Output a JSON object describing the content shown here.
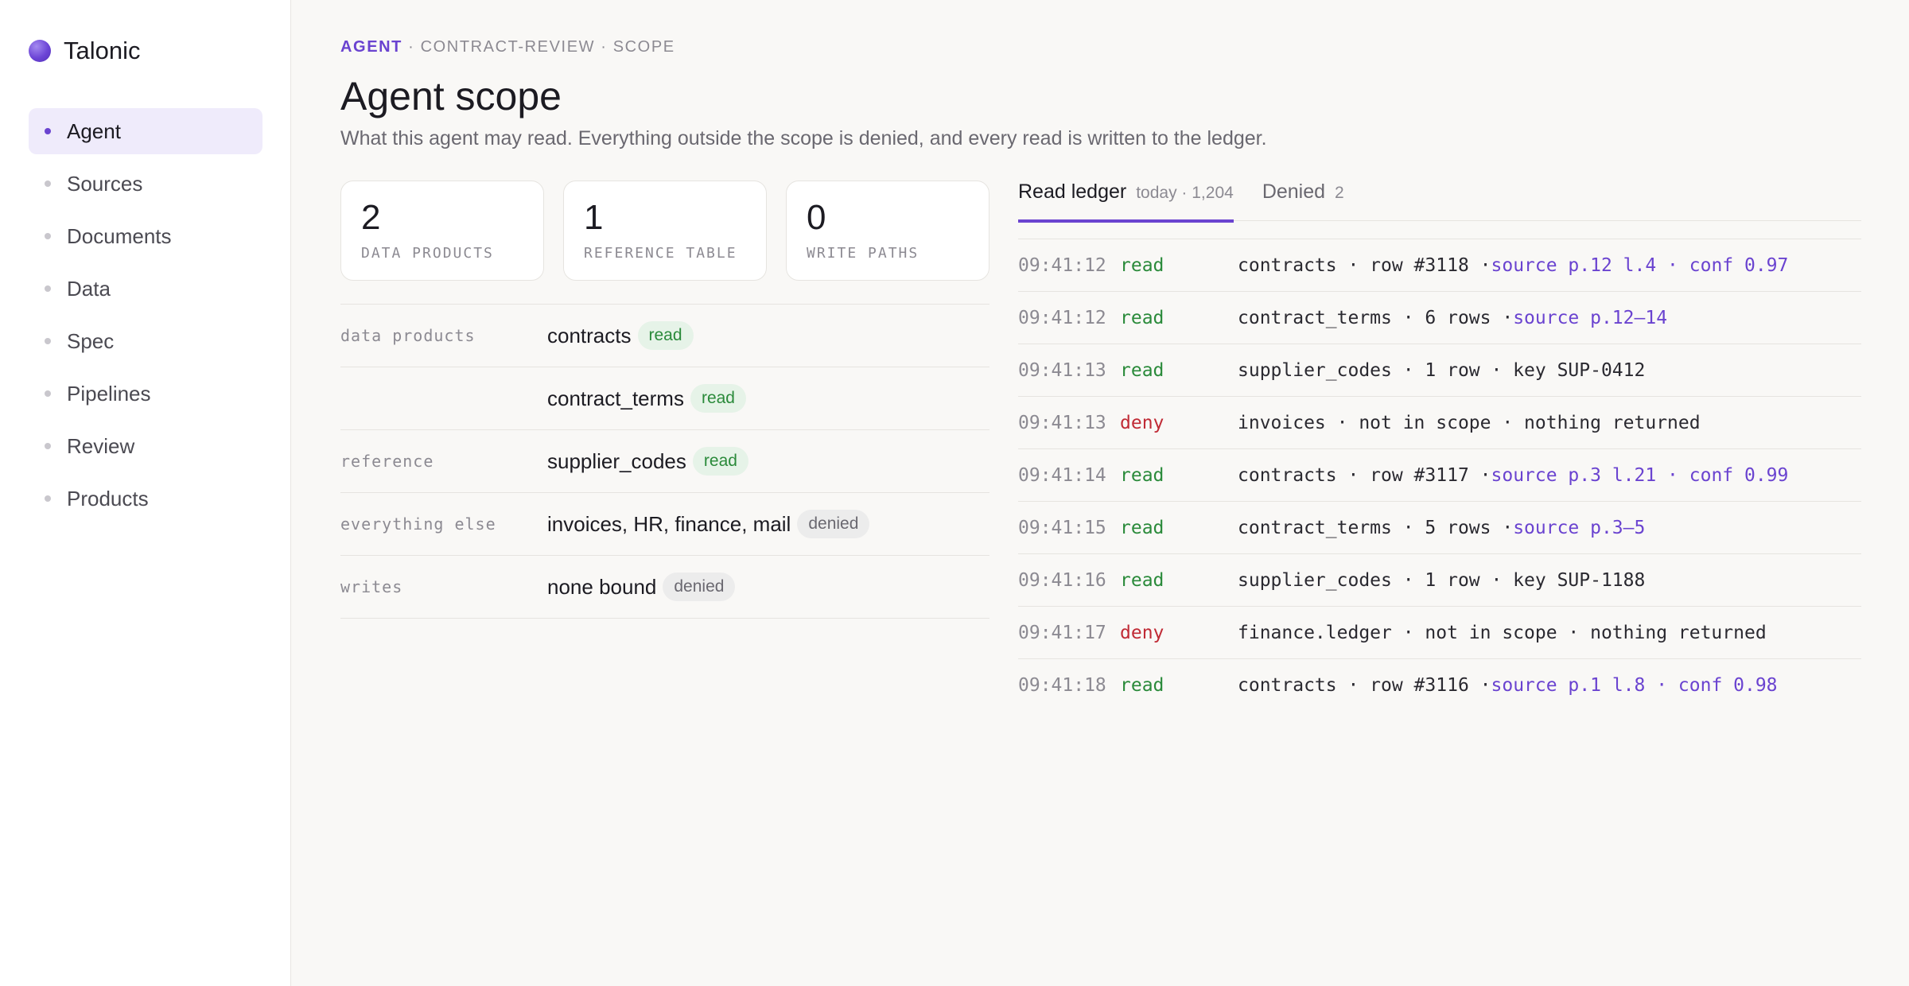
{
  "app": {
    "name": "Talonic"
  },
  "sidebar": {
    "items": [
      {
        "label": "Agent",
        "active": true
      },
      {
        "label": "Sources"
      },
      {
        "label": "Documents"
      },
      {
        "label": "Data"
      },
      {
        "label": "Spec"
      },
      {
        "label": "Pipelines"
      },
      {
        "label": "Review"
      },
      {
        "label": "Products"
      }
    ]
  },
  "header": {
    "breadcrumb": {
      "accent": "AGENT",
      "rest": " · CONTRACT-REVIEW · SCOPE"
    },
    "title": "Agent scope",
    "subtitle": "What this agent may read. Everything outside the scope is denied, and every read is written to the ledger."
  },
  "stats": [
    {
      "value": "2",
      "label": "DATA PRODUCTS"
    },
    {
      "value": "1",
      "label": "REFERENCE TABLE"
    },
    {
      "value": "0",
      "label": "WRITE PATHS"
    }
  ],
  "scope": [
    {
      "label": "data products",
      "value": "contracts",
      "status": "read"
    },
    {
      "label": "",
      "value": "contract_terms",
      "status": "read"
    },
    {
      "label": "reference",
      "value": "supplier_codes",
      "status": "read"
    },
    {
      "label": "everything else",
      "value": "invoices, HR, finance, mail",
      "status": "denied"
    },
    {
      "label": "writes",
      "value": "none bound",
      "status": "denied"
    }
  ],
  "ledger": {
    "tabs": [
      {
        "label": "Read ledger",
        "meta": "today · 1,204",
        "active": true
      },
      {
        "label": "Denied",
        "meta": "2"
      }
    ],
    "entries": [
      {
        "time": "09:41:12",
        "action": "read",
        "desc": "contracts · row #3118 · ",
        "source": "source p.12 l.4 · conf 0.97"
      },
      {
        "time": "09:41:12",
        "action": "read",
        "desc": "contract_terms · 6 rows · ",
        "source": "source p.12–14"
      },
      {
        "time": "09:41:13",
        "action": "read",
        "desc": "supplier_codes · 1 row · key SUP-0412",
        "source": ""
      },
      {
        "time": "09:41:13",
        "action": "deny",
        "desc": "invoices · not in scope · nothing returned",
        "source": ""
      },
      {
        "time": "09:41:14",
        "action": "read",
        "desc": "contracts · row #3117 · ",
        "source": "source p.3 l.21 · conf 0.99"
      },
      {
        "time": "09:41:15",
        "action": "read",
        "desc": "contract_terms · 5 rows · ",
        "source": "source p.3–5"
      },
      {
        "time": "09:41:16",
        "action": "read",
        "desc": "supplier_codes · 1 row · key SUP-1188",
        "source": ""
      },
      {
        "time": "09:41:17",
        "action": "deny",
        "desc": "finance.ledger · not in scope · nothing returned",
        "source": ""
      },
      {
        "time": "09:41:18",
        "action": "read",
        "desc": "contracts · row #3116 · ",
        "source": "source p.1 l.8 · conf 0.98"
      }
    ]
  }
}
